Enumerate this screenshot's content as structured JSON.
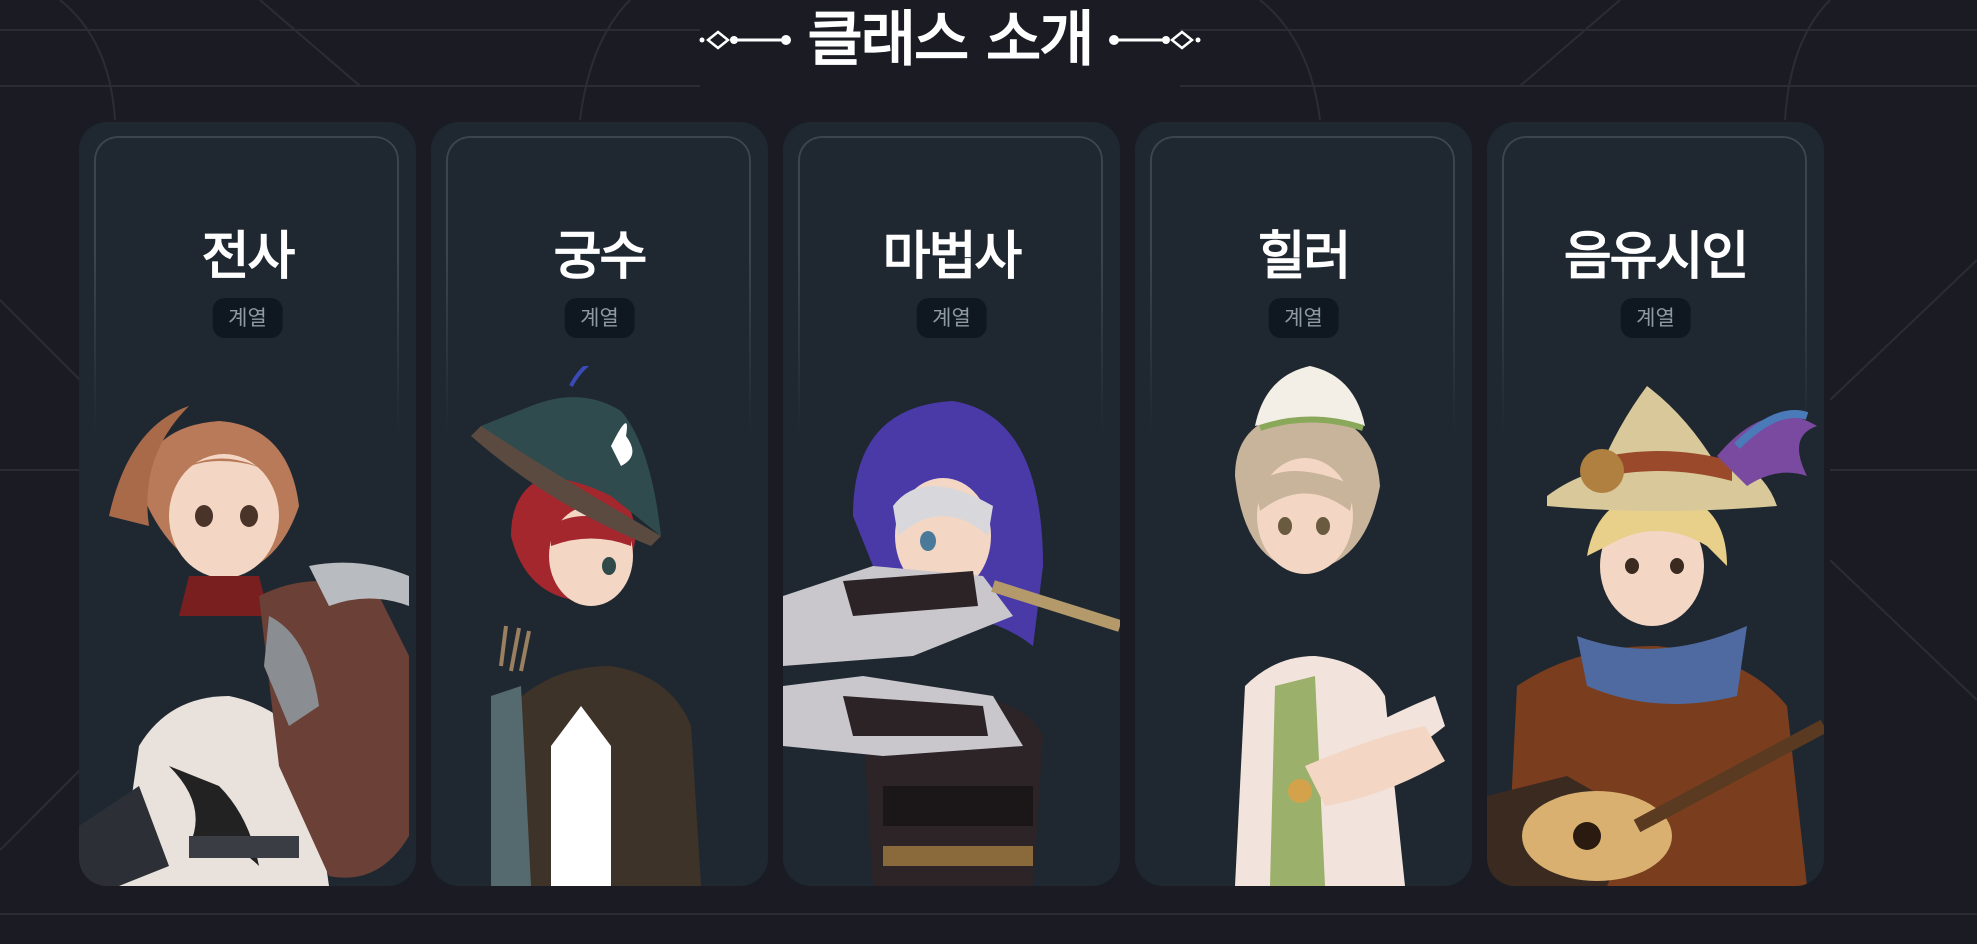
{
  "header": {
    "title": "클래스 소개"
  },
  "classes": [
    {
      "name": "전사",
      "tag": "계열"
    },
    {
      "name": "궁수",
      "tag": "계열"
    },
    {
      "name": "마법사",
      "tag": "계열"
    },
    {
      "name": "힐러",
      "tag": "계열"
    },
    {
      "name": "음유시인",
      "tag": "계열"
    }
  ],
  "colors": {
    "background": "#1b1c23",
    "card": "#1f2831",
    "tag_bg": "#0f1820",
    "tag_text": "#8e9aa3"
  }
}
